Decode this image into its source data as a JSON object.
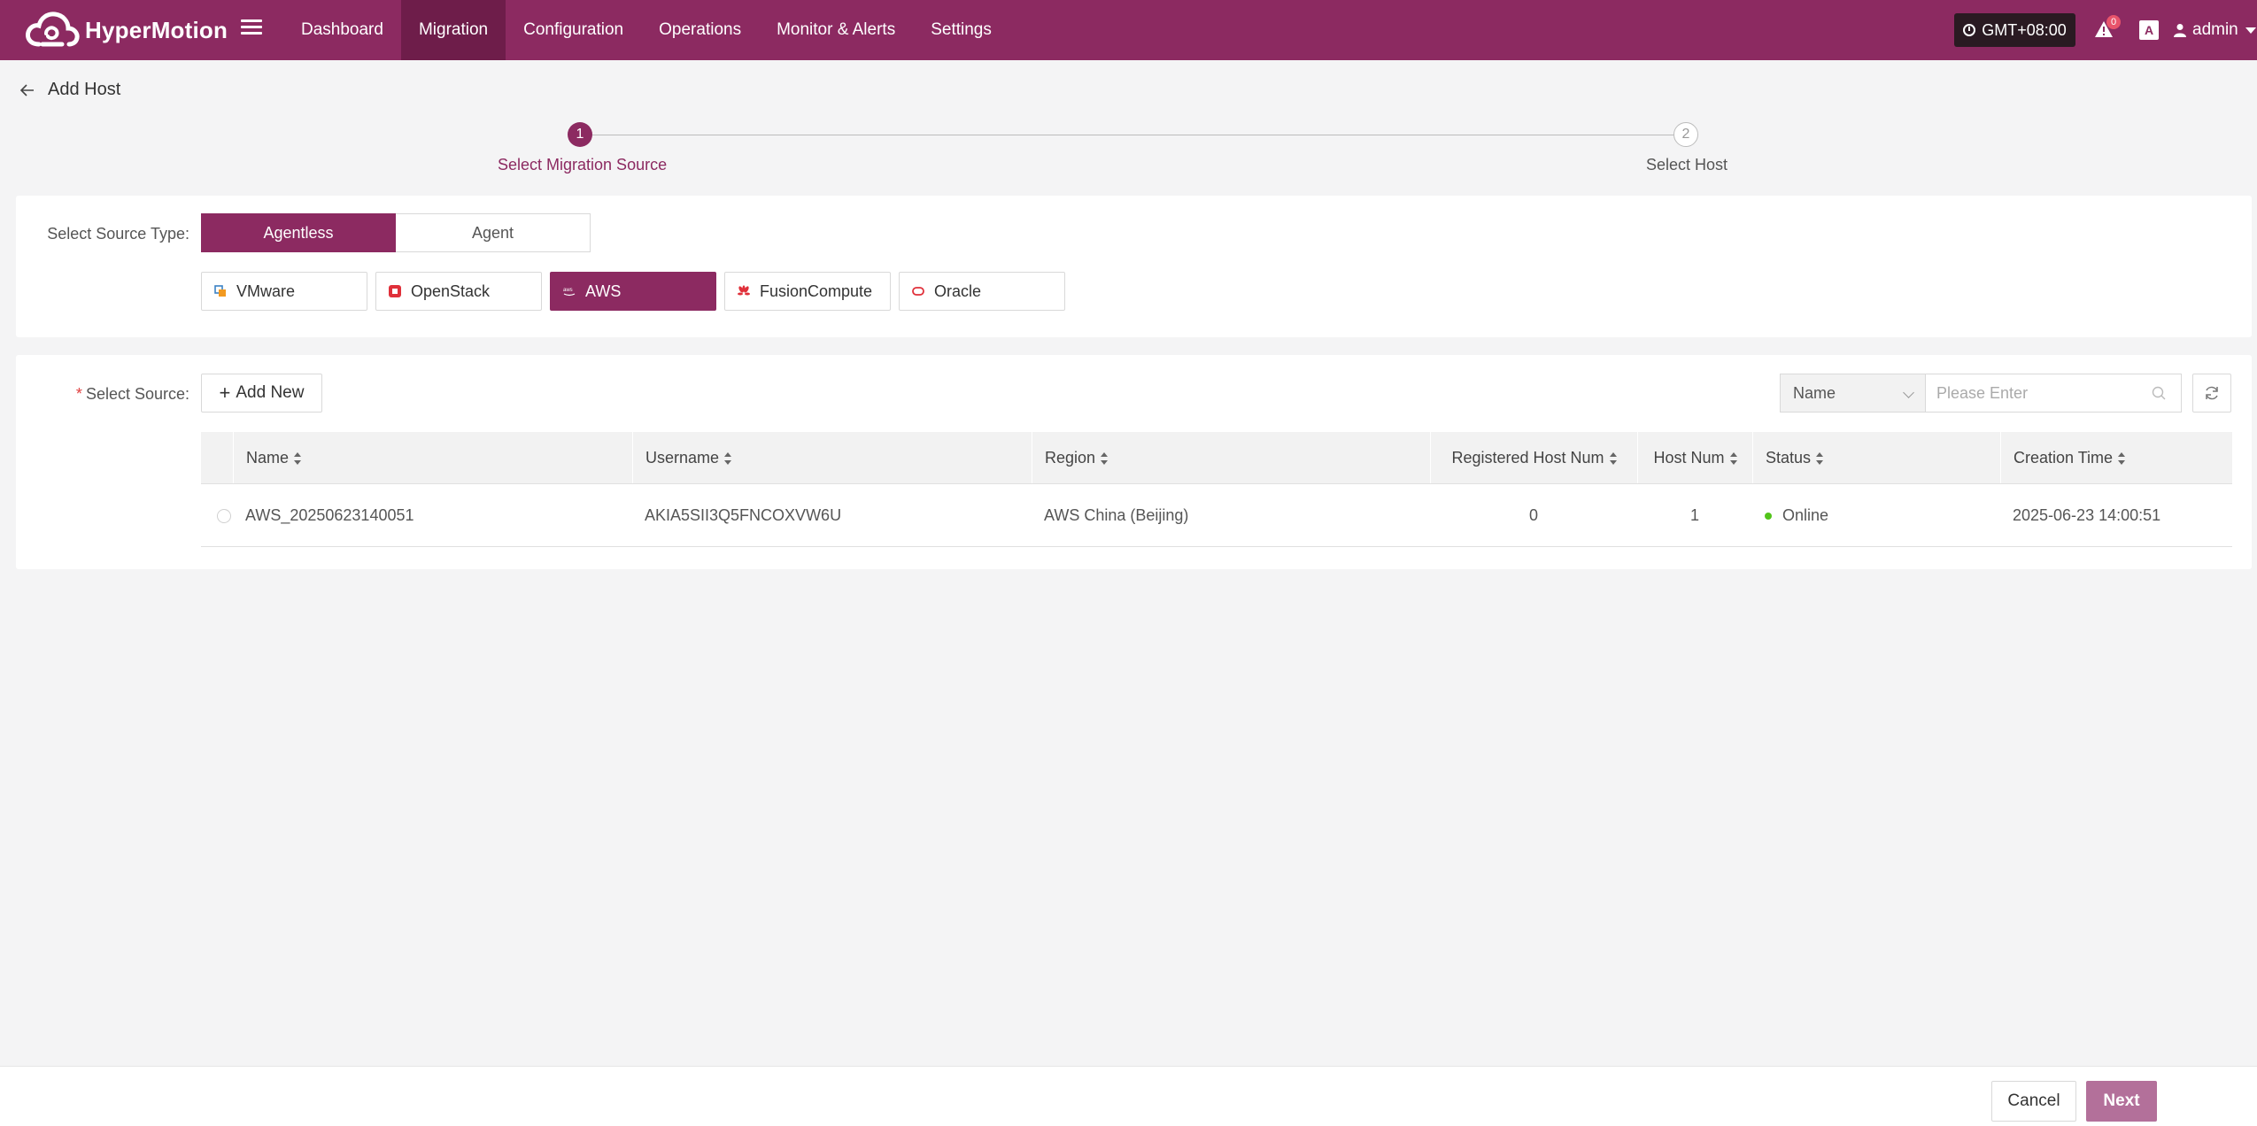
{
  "brand": {
    "name": "HyperMotion"
  },
  "nav": {
    "items": [
      {
        "label": "Dashboard",
        "active": false
      },
      {
        "label": "Migration",
        "active": true
      },
      {
        "label": "Configuration",
        "active": false
      },
      {
        "label": "Operations",
        "active": false
      },
      {
        "label": "Monitor & Alerts",
        "active": false
      },
      {
        "label": "Settings",
        "active": false
      }
    ]
  },
  "header": {
    "timezone": "GMT+08:00",
    "alert_count": "0",
    "lang_icon": "A",
    "user": "admin"
  },
  "page": {
    "title": "Add Host"
  },
  "steps": [
    {
      "number": "1",
      "label": "Select Migration Source",
      "state": "active"
    },
    {
      "number": "2",
      "label": "Select Host",
      "state": "pending"
    }
  ],
  "source_type": {
    "label": "Select Source Type:",
    "options": [
      {
        "label": "Agentless",
        "selected": true
      },
      {
        "label": "Agent",
        "selected": false
      }
    ]
  },
  "platforms": [
    {
      "label": "VMware",
      "icon": "vmware-icon",
      "selected": false
    },
    {
      "label": "OpenStack",
      "icon": "openstack-icon",
      "selected": false
    },
    {
      "label": "AWS",
      "icon": "aws-icon",
      "selected": true
    },
    {
      "label": "FusionCompute",
      "icon": "huawei-icon",
      "selected": false
    },
    {
      "label": "Oracle",
      "icon": "oracle-icon",
      "selected": false
    }
  ],
  "source": {
    "label": "Select Source:",
    "add_new_label": "Add New",
    "search_field": "Name",
    "search_placeholder": "Please Enter"
  },
  "table": {
    "columns": [
      "Name",
      "Username",
      "Region",
      "Registered Host Num",
      "Host Num",
      "Status",
      "Creation Time"
    ],
    "rows": [
      {
        "name": "AWS_20250623140051",
        "username": "AKIA5SII3Q5FNCOXVW6U",
        "region": "AWS China (Beijing)",
        "registered_host_num": "0",
        "host_num": "1",
        "status": "Online",
        "creation_time": "2025-06-23 14:00:51"
      }
    ]
  },
  "footer": {
    "cancel_label": "Cancel",
    "next_label": "Next"
  },
  "colors": {
    "brand": "#8c2a61",
    "brand_dark": "#6e1d4a",
    "next_disabled": "#b3709a",
    "status_online": "#52c41a"
  }
}
